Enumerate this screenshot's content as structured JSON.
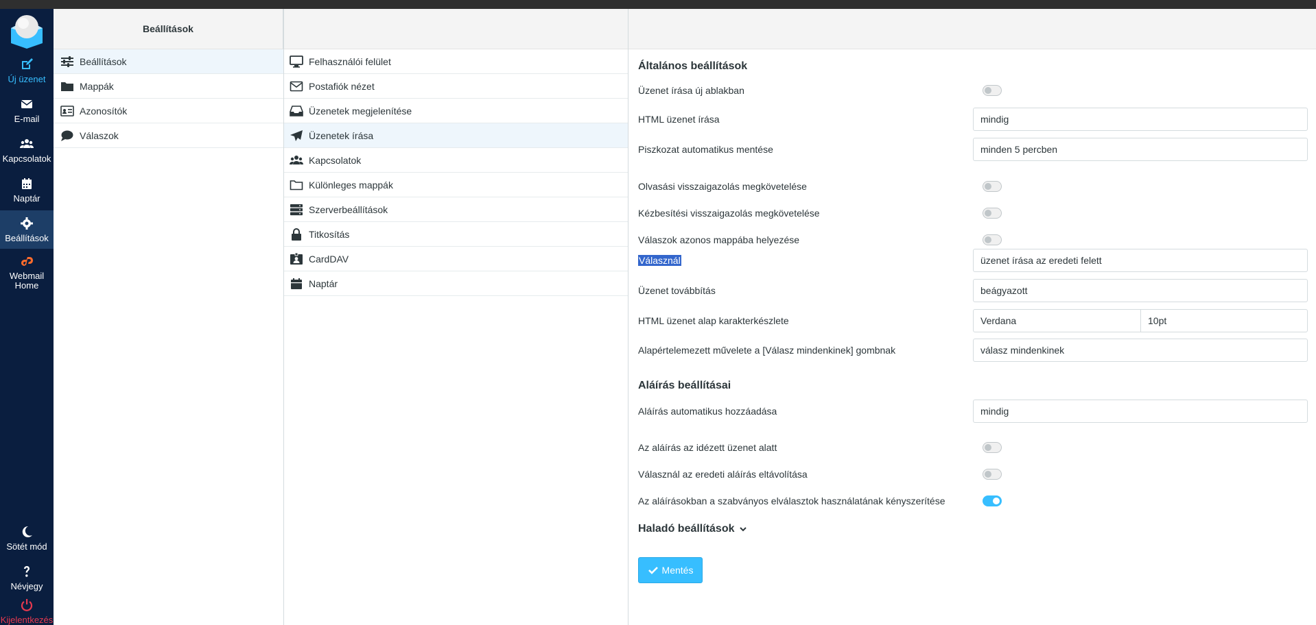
{
  "nav": {
    "compose": "Új üzenet",
    "mail": "E-mail",
    "contacts": "Kapcsolatok",
    "calendar": "Naptár",
    "settings": "Beállítások",
    "cpanel": "Webmail Home",
    "dark_mode": "Sötét mód",
    "about": "Névjegy",
    "logout": "Kijelentkezés"
  },
  "col1": {
    "header": "Beállítások",
    "items": [
      "Beállítások",
      "Mappák",
      "Azonosítók",
      "Válaszok"
    ]
  },
  "col2": {
    "items": [
      "Felhasználói felület",
      "Postafiók nézet",
      "Üzenetek megjelenítése",
      "Üzenetek írása",
      "Kapcsolatok",
      "Különleges mappák",
      "Szerverbeállítások",
      "Titkosítás",
      "CardDAV",
      "Naptár"
    ]
  },
  "general": {
    "title": "Általános beállítások",
    "compose_new_window": "Üzenet írása új ablakban",
    "html_compose": "HTML üzenet írása",
    "html_compose_value": "mindig",
    "autosave": "Piszkozat automatikus mentése",
    "autosave_value": "minden 5 percben",
    "read_receipt": "Olvasási visszaigazolás megkövetelése",
    "delivery_receipt": "Kézbesítési visszaigazolás megkövetelése",
    "reply_same_folder": "Válaszok azonos mappába helyezése",
    "reply_mode": "Válasznál",
    "reply_mode_value": "üzenet írása az eredeti felett",
    "forward": "Üzenet továbbítás",
    "forward_value": "beágyazott",
    "default_font": "HTML üzenet alap karakterkészlete",
    "font_value": "Verdana",
    "font_size_value": "10pt",
    "reply_all": "Alapértelemezett művelete a [Válasz mindenkinek] gombnak",
    "reply_all_value": "válasz mindenkinek"
  },
  "signature": {
    "title": "Aláírás beállításai",
    "auto_add": "Aláírás automatikus hozzáadása",
    "auto_add_value": "mindig",
    "below_quote": "Az aláírás az idézett üzenet alatt",
    "strip_on_reply": "Válasznál az eredeti aláírás eltávolítása",
    "force_separator": "Az aláírásokban a szabványos elválasztok használatának kényszerítése"
  },
  "advanced": "Haladó beállítások",
  "save": "Mentés",
  "colors": {
    "nav_bg": "#0a1e3f",
    "accent": "#37beff",
    "logout": "#e6394f"
  }
}
